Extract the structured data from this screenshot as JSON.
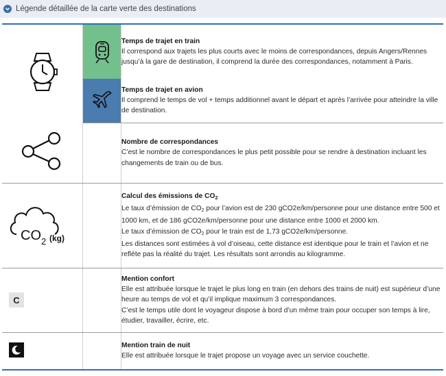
{
  "header": {
    "title": "Légende détaillée de la carte verte des destinations"
  },
  "rows": {
    "train": {
      "title": "Temps de trajet en train",
      "desc": "Il correspond aux trajets les plus courts avec le moins de correspondances, depuis Angers/Rennes jusqu’à la gare de destination, il comprend  la durée des correspondances, notamment à Paris."
    },
    "avion": {
      "title": "Temps de trajet en avion",
      "desc": "Il comprend le temps de vol + temps additionnel avant le départ et après l’arrivée pour atteindre la ville de destination."
    },
    "correspondances": {
      "title": "Nombre de correspondances",
      "desc": "C’est le nombre de correspondances le plus petit possible pour se rendre à destination incluant les changements de train ou de bus."
    },
    "emissions": {
      "title_prefix": "Calcul des émissions de CO",
      "sub": "2",
      "l1a": "Le taux d’émission de CO",
      "l1b": " pour l’avion est de 230 gCO2e/km/personne pour une distance entre 500 et 1000 km, et de 186 gCO2e/km/personne pour une distance entre 1000 et 2000 km.",
      "l2a": "Le taux d’émission de CO",
      "l2b": " pour le train est de 1,73 gCO2e/km/personne.",
      "l3": "Les distances sont estimées à vol d’oiseau, cette distance est identique pour le train et l’avion et ne reflète pas la réalité du trajet. Les résultats sont arrondis au kilogramme.",
      "icon_text": "CO",
      "icon_sub": "2",
      "icon_unit": "(kg)"
    },
    "confort": {
      "title": "Mention confort",
      "badge": "C",
      "desc1": "Elle est attribuée lorsque le trajet le plus long en train (en dehors des trains de nuit) est supérieur d’une heure au temps de vol et qu’il implique maximum 3 correspondances.",
      "desc2": "C’est le temps utile dont le voyageur dispose à bord d’un même train pour occuper son temps à lire, étudier, travailler, écrire, etc."
    },
    "nuit": {
      "title": "Mention train de nuit",
      "desc": "Elle est attribuée lorsque le trajet propose un voyage avec un service couchette."
    }
  },
  "colors": {
    "train": "#74c08c",
    "avion": "#4a7cb0",
    "accent": "#2f6fb1"
  }
}
